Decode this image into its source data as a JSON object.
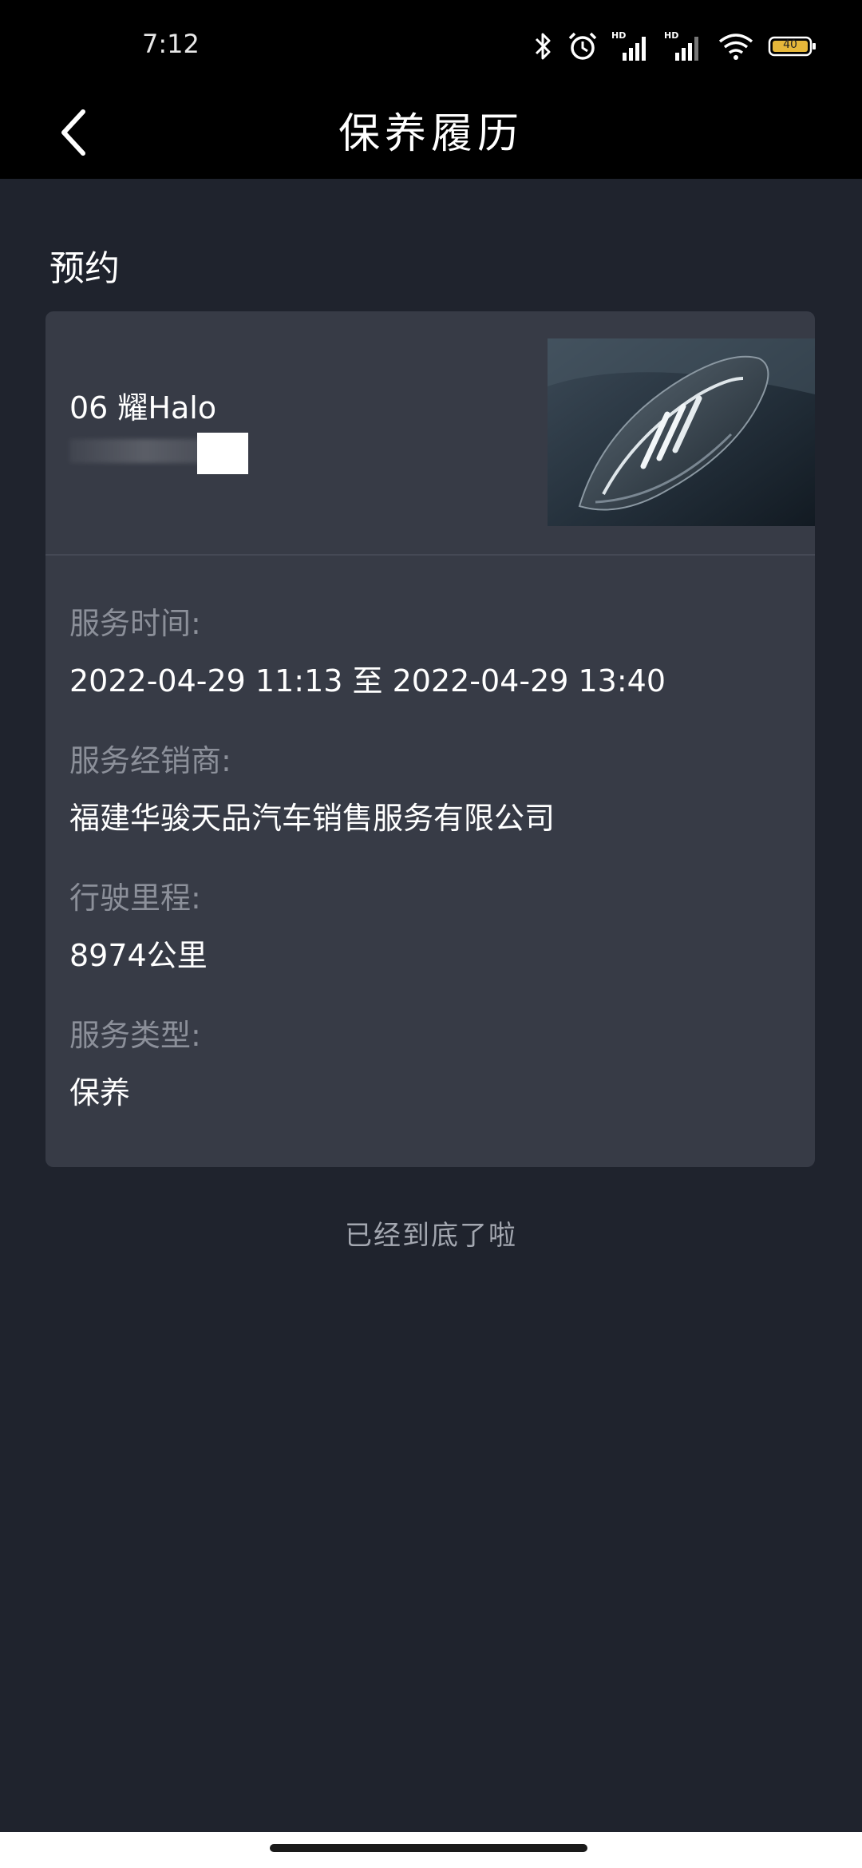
{
  "status_bar": {
    "time": "7:12",
    "battery_level": "40",
    "icons": [
      "bluetooth-icon",
      "alarm-icon",
      "signal-hd-icon",
      "signal-hd-icon",
      "wifi-icon",
      "battery-icon"
    ]
  },
  "nav": {
    "title": "保养履历",
    "back_icon": "chevron-left-icon"
  },
  "section": {
    "title": "预约"
  },
  "record": {
    "vehicle_name": "06 耀Halo",
    "details": [
      {
        "label": "服务时间:",
        "value": "2022-04-29 11:13 至 2022-04-29 13:40"
      },
      {
        "label": "服务经销商:",
        "value": "福建华骏天品汽车销售服务有限公司"
      },
      {
        "label": "行驶里程:",
        "value": "8974公里"
      },
      {
        "label": "服务类型:",
        "value": "保养"
      }
    ]
  },
  "footer": {
    "end_text": "已经到底了啦"
  },
  "colors": {
    "background": "#1f232d",
    "card": "#373b46",
    "label": "#8c909a",
    "value": "#ffffff",
    "topbar": "#000000"
  }
}
